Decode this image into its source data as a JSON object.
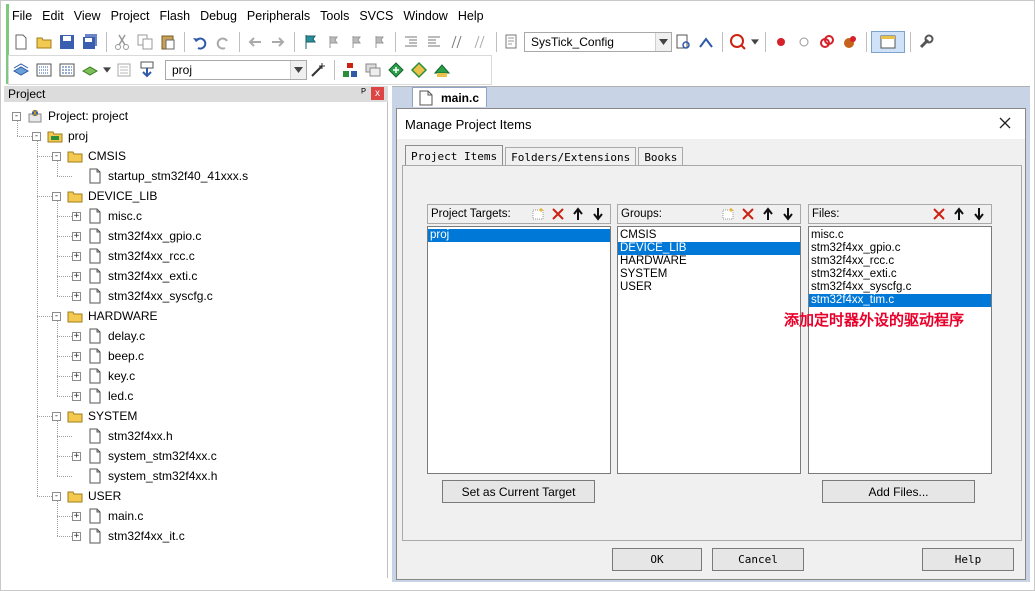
{
  "menu": [
    "File",
    "Edit",
    "View",
    "Project",
    "Flash",
    "Debug",
    "Peripherals",
    "Tools",
    "SVCS",
    "Window",
    "Help"
  ],
  "toolbar": {
    "function_combo": "SysTick_Config",
    "target_combo": "proj"
  },
  "project_panel": {
    "title": "Project",
    "pin_glyph": "ᴾ",
    "close_glyph": "x",
    "tree": [
      {
        "label": "Project: project",
        "level": 0,
        "icon": "project-icon",
        "expander": "-"
      },
      {
        "label": "proj",
        "level": 1,
        "icon": "target-icon",
        "expander": "-"
      },
      {
        "label": "CMSIS",
        "level": 2,
        "icon": "folder-icon",
        "expander": "-"
      },
      {
        "label": "startup_stm32f40_41xxx.s",
        "level": 3,
        "icon": "file-icon",
        "expander": ""
      },
      {
        "label": "DEVICE_LIB",
        "level": 2,
        "icon": "folder-icon",
        "expander": "-"
      },
      {
        "label": "misc.c",
        "level": 3,
        "icon": "file-icon",
        "expander": "+"
      },
      {
        "label": "stm32f4xx_gpio.c",
        "level": 3,
        "icon": "file-icon",
        "expander": "+"
      },
      {
        "label": "stm32f4xx_rcc.c",
        "level": 3,
        "icon": "file-icon",
        "expander": "+"
      },
      {
        "label": "stm32f4xx_exti.c",
        "level": 3,
        "icon": "file-icon",
        "expander": "+"
      },
      {
        "label": "stm32f4xx_syscfg.c",
        "level": 3,
        "icon": "file-icon",
        "expander": "+"
      },
      {
        "label": "HARDWARE",
        "level": 2,
        "icon": "folder-icon",
        "expander": "-"
      },
      {
        "label": "delay.c",
        "level": 3,
        "icon": "file-icon",
        "expander": "+"
      },
      {
        "label": "beep.c",
        "level": 3,
        "icon": "file-icon",
        "expander": "+"
      },
      {
        "label": "key.c",
        "level": 3,
        "icon": "file-icon",
        "expander": "+"
      },
      {
        "label": "led.c",
        "level": 3,
        "icon": "file-icon",
        "expander": "+"
      },
      {
        "label": "SYSTEM",
        "level": 2,
        "icon": "folder-icon",
        "expander": "-"
      },
      {
        "label": "stm32f4xx.h",
        "level": 3,
        "icon": "file-icon",
        "expander": ""
      },
      {
        "label": "system_stm32f4xx.c",
        "level": 3,
        "icon": "file-icon",
        "expander": "+"
      },
      {
        "label": "system_stm32f4xx.h",
        "level": 3,
        "icon": "file-icon",
        "expander": ""
      },
      {
        "label": "USER",
        "level": 2,
        "icon": "folder-icon",
        "expander": "-"
      },
      {
        "label": "main.c",
        "level": 3,
        "icon": "file-icon",
        "expander": "+"
      },
      {
        "label": "stm32f4xx_it.c",
        "level": 3,
        "icon": "file-icon",
        "expander": "+"
      }
    ]
  },
  "editor": {
    "tab_label": "main.c"
  },
  "dialog": {
    "title": "Manage Project Items",
    "tabs": [
      "Project Items",
      "Folders/Extensions",
      "Books"
    ],
    "targets": {
      "header": "Project Targets:",
      "items": [
        "proj"
      ],
      "selected": "proj"
    },
    "groups": {
      "header": "Groups:",
      "items": [
        "CMSIS",
        "DEVICE_LIB",
        "HARDWARE",
        "SYSTEM",
        "USER"
      ],
      "selected": "DEVICE_LIB"
    },
    "files": {
      "header": "Files:",
      "items": [
        "misc.c",
        "stm32f4xx_gpio.c",
        "stm32f4xx_rcc.c",
        "stm32f4xx_exti.c",
        "stm32f4xx_syscfg.c",
        "stm32f4xx_tim.c"
      ],
      "selected": "stm32f4xx_tim.c"
    },
    "set_target_button": "Set as Current Target",
    "add_files_button": "Add Files...",
    "ok_button": "OK",
    "cancel_button": "Cancel",
    "help_button": "Help"
  },
  "annotation": {
    "text": "添加定时器外设的驱动程序",
    "color": "#e8002a"
  },
  "colors": {
    "selection": "#0078d7",
    "editor_bg": "#c8d4e6"
  }
}
